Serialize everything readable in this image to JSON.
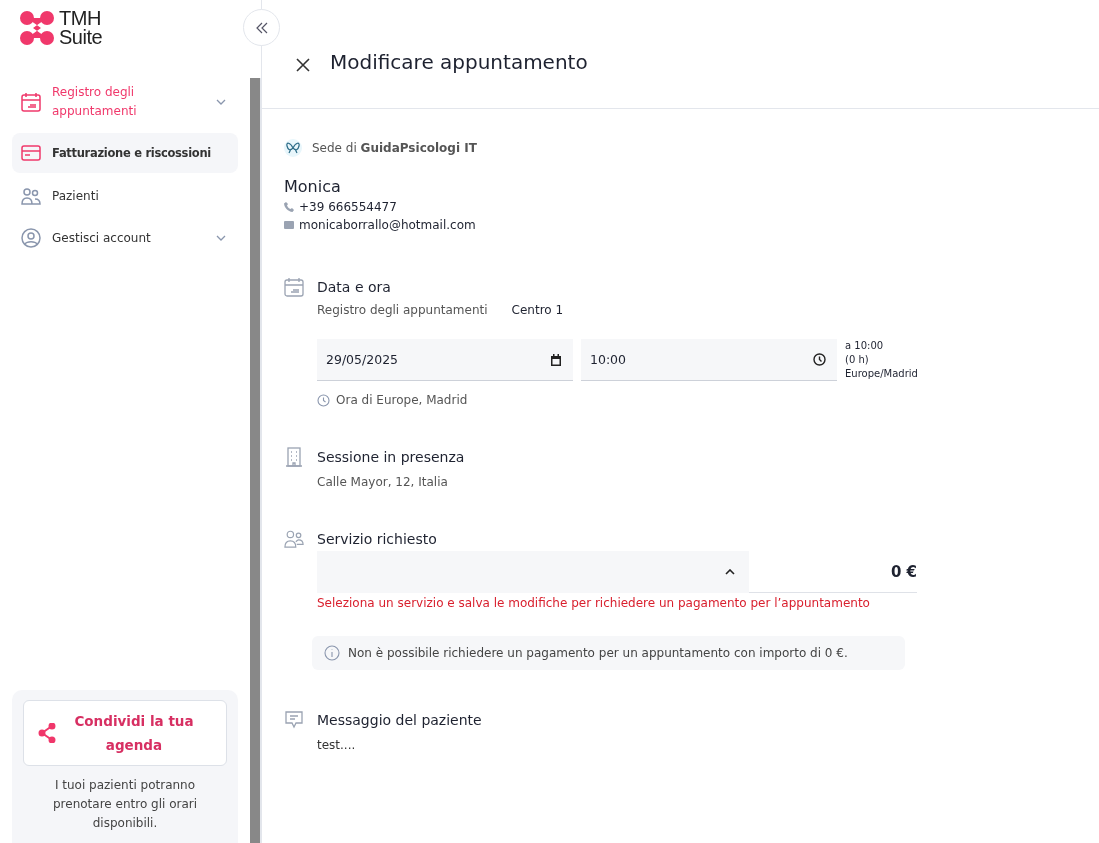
{
  "logo": {
    "line1": "TMH",
    "line2": "Suite"
  },
  "sidebar": {
    "items": [
      {
        "label": "Registro degli appuntamenti",
        "kind": "calendar",
        "highlighted": true,
        "selected": false,
        "expandable": true
      },
      {
        "label": "Fatturazione e riscossioni",
        "kind": "card",
        "highlighted": false,
        "selected": true,
        "expandable": false
      },
      {
        "label": "Pazienti",
        "kind": "people",
        "highlighted": false,
        "selected": false,
        "expandable": false
      },
      {
        "label": "Gestisci account",
        "kind": "user",
        "highlighted": false,
        "selected": false,
        "expandable": true
      }
    ],
    "share_card": {
      "button": "Condividi la tua agenda",
      "text": "I tuoi pazienti potranno prenotare entro gli orari disponibili."
    }
  },
  "header": {
    "title": "Modificare appuntamento"
  },
  "location": {
    "text": "Sede di **GuidaPsicologi IT**"
  },
  "patient": {
    "name": "Monica",
    "phone": "+39 666554477",
    "email": "monicaborrallo@hotmail.com"
  },
  "date_time": {
    "title": "Data e ora",
    "calendar_label": "Registro degli appuntamenti",
    "calendar_value": "Centro 1",
    "date": "29/05/2025",
    "time": "10:00",
    "end_lines": [
      "a 10:00",
      "(0 h)",
      "Europe/Madrid"
    ],
    "timezone": "Ora di Europe, Madrid"
  },
  "session": {
    "title": "Sessione in presenza",
    "address": "Calle Mayor, 12, Italia"
  },
  "service": {
    "title": "Servizio richiesto",
    "expanded": true,
    "price": "0 €",
    "error": "Seleziona un servizio e salva le modifiche per richiedere un pagamento per l’appuntamento",
    "info": "Non è possibile richiedere un pagamento per un appuntamento con importo di 0 €."
  },
  "message": {
    "title": "Messaggio del paziente",
    "text": "test...."
  }
}
